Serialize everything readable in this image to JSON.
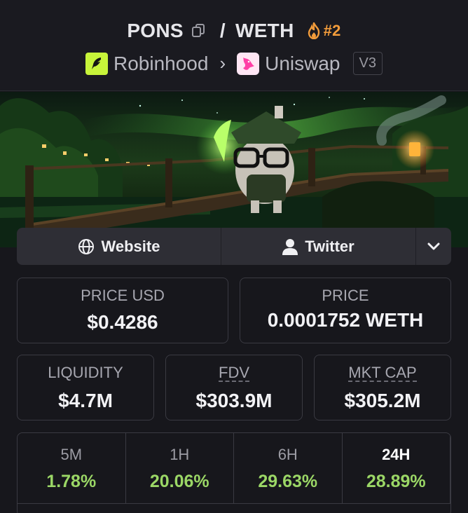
{
  "pair": {
    "base": "PONS",
    "quote": "WETH",
    "separator": "/",
    "rank": "#2",
    "chain": "Robinhood",
    "dex": "Uniswap",
    "version": "V3"
  },
  "links": {
    "website": "Website",
    "twitter": "Twitter"
  },
  "stats": {
    "price_usd_label": "PRICE USD",
    "price_usd": "$0.4286",
    "price_label": "PRICE",
    "price": "0.0001752 WETH",
    "liquidity_label": "LIQUIDITY",
    "liquidity": "$4.7M",
    "fdv_label": "FDV",
    "fdv": "$303.9M",
    "mcap_label": "MKT CAP",
    "mcap": "$305.2M"
  },
  "timeframes": [
    {
      "label": "5M",
      "change": "1.78%"
    },
    {
      "label": "1H",
      "change": "20.06%"
    },
    {
      "label": "6H",
      "change": "29.63%"
    },
    {
      "label": "24H",
      "change": "28.89%"
    }
  ],
  "colors": {
    "positive": "#9bd766",
    "rank": "#f29c3b",
    "chain_brand": "#c7f43a",
    "dex_brand": "#ff3fa6"
  }
}
